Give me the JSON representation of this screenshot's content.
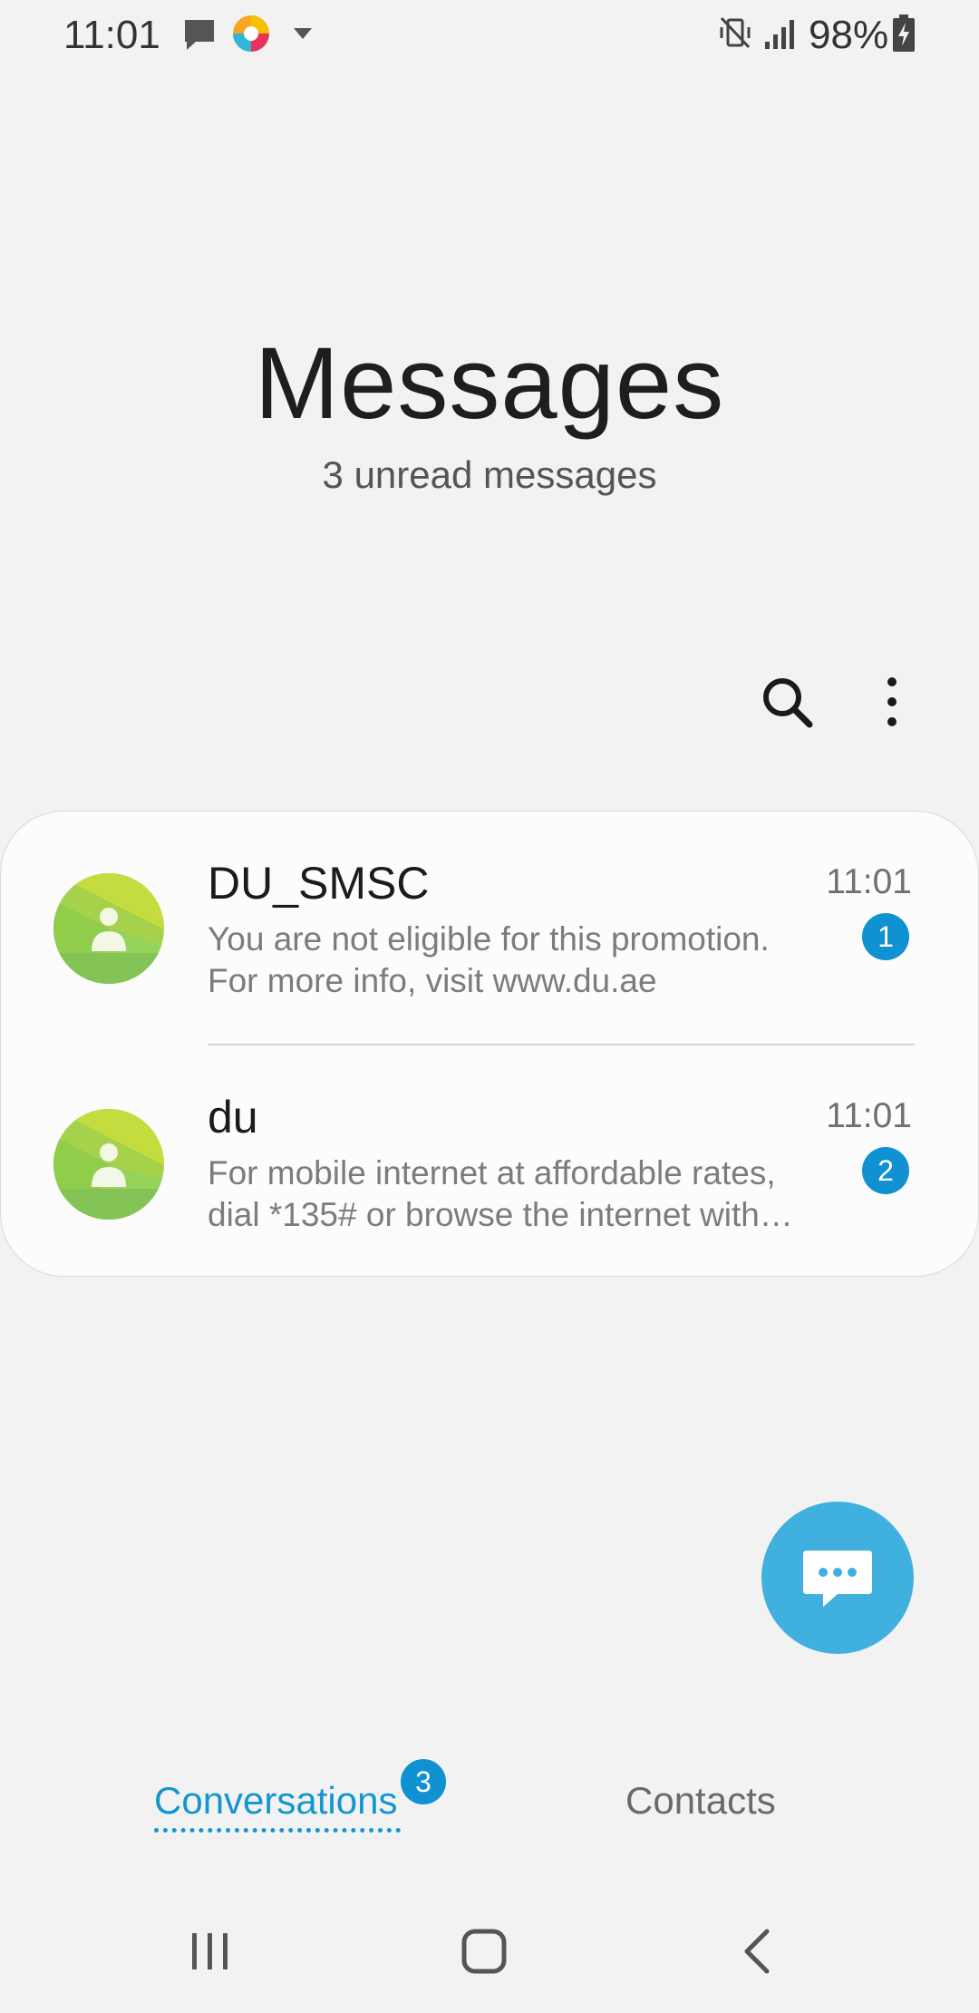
{
  "status_bar": {
    "time": "11:01",
    "battery": "98%",
    "icons": [
      "message-icon",
      "app-icon",
      "caret-down-icon",
      "vibrate-mute-icon",
      "signal-icon",
      "battery-charging-icon"
    ]
  },
  "header": {
    "title": "Messages",
    "subtitle": "3 unread messages"
  },
  "toolbar": {
    "icons": [
      "search-icon",
      "more-vertical-icon"
    ]
  },
  "conversations": [
    {
      "sender": "DU_SMSC",
      "time": "11:01",
      "preview_line1": "You are not eligible for this promotion.",
      "preview_line2": "For more info, visit www.du.ae",
      "unread": "1"
    },
    {
      "sender": "du",
      "time": "11:01",
      "preview_line1": "For mobile internet at affordable rates,",
      "preview_line2": "dial *135# or browse the internet with…",
      "unread": "2"
    }
  ],
  "fab": {
    "icon": "compose-message-icon"
  },
  "tabs": {
    "conversations": "Conversations",
    "conversations_badge": "3",
    "contacts": "Contacts"
  },
  "colors": {
    "accent": "#1496cf",
    "badge": "#0f91d2",
    "fab": "#40b0de",
    "background": "#f2f2f2"
  }
}
